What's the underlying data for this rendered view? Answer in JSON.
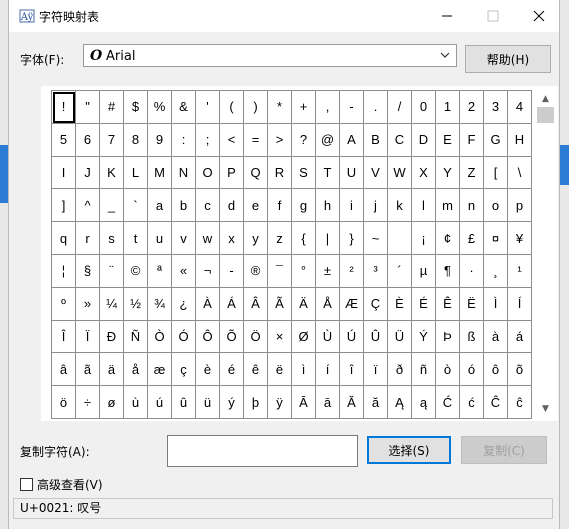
{
  "window": {
    "title": "字符映射表"
  },
  "font": {
    "label": "字体(F):",
    "selected": "Arial",
    "help_label": "帮助(H)"
  },
  "characters": [
    [
      "!",
      "\"",
      "#",
      "$",
      "%",
      "&",
      "'",
      "(",
      ")",
      "*",
      "+",
      ",",
      "-",
      ".",
      "/",
      "0",
      "1",
      "2",
      "3",
      "4"
    ],
    [
      "5",
      "6",
      "7",
      "8",
      "9",
      ":",
      ";",
      "<",
      "=",
      ">",
      "?",
      "@",
      "A",
      "B",
      "C",
      "D",
      "E",
      "F",
      "G",
      "H"
    ],
    [
      "I",
      "J",
      "K",
      "L",
      "M",
      "N",
      "O",
      "P",
      "Q",
      "R",
      "S",
      "T",
      "U",
      "V",
      "W",
      "X",
      "Y",
      "Z",
      "[",
      "\\"
    ],
    [
      "]",
      "^",
      "_",
      "`",
      "a",
      "b",
      "c",
      "d",
      "e",
      "f",
      "g",
      "h",
      "i",
      "j",
      "k",
      "l",
      "m",
      "n",
      "o",
      "p"
    ],
    [
      "q",
      "r",
      "s",
      "t",
      "u",
      "v",
      "w",
      "x",
      "y",
      "z",
      "{",
      "|",
      "}",
      "~",
      " ",
      "¡",
      "¢",
      "£",
      "¤",
      "¥"
    ],
    [
      "¦",
      "§",
      "¨",
      "©",
      "ª",
      "«",
      "¬",
      "-",
      "®",
      "¯",
      "°",
      "±",
      "²",
      "³",
      "´",
      "µ",
      "¶",
      "·",
      "¸",
      "¹"
    ],
    [
      "º",
      "»",
      "¼",
      "½",
      "¾",
      "¿",
      "À",
      "Á",
      "Â",
      "Ã",
      "Ä",
      "Å",
      "Æ",
      "Ç",
      "È",
      "É",
      "Ê",
      "Ë",
      "Ì",
      "Í"
    ],
    [
      "Î",
      "Ï",
      "Ð",
      "Ñ",
      "Ò",
      "Ó",
      "Ô",
      "Õ",
      "Ö",
      "×",
      "Ø",
      "Ù",
      "Ú",
      "Û",
      "Ü",
      "Ý",
      "Þ",
      "ß",
      "à",
      "á"
    ],
    [
      "â",
      "ã",
      "ä",
      "å",
      "æ",
      "ç",
      "è",
      "é",
      "ê",
      "ë",
      "ì",
      "í",
      "î",
      "ï",
      "ð",
      "ñ",
      "ò",
      "ó",
      "ô",
      "õ"
    ],
    [
      "ö",
      "÷",
      "ø",
      "ù",
      "ú",
      "û",
      "ü",
      "ý",
      "þ",
      "ÿ",
      "Ā",
      "ā",
      "Ă",
      "ă",
      "Ą",
      "ą",
      "Ć",
      "ć",
      "Ĉ",
      "ĉ"
    ]
  ],
  "copy": {
    "label": "复制字符(A):",
    "value": "",
    "select_label": "选择(S)",
    "copy_label": "复制(C)"
  },
  "advanced": {
    "label": "高级查看(V)"
  },
  "status": {
    "text": "U+0021: 叹号"
  },
  "colors": {
    "accent": "#0078d7",
    "background": "#f0f0f0"
  }
}
